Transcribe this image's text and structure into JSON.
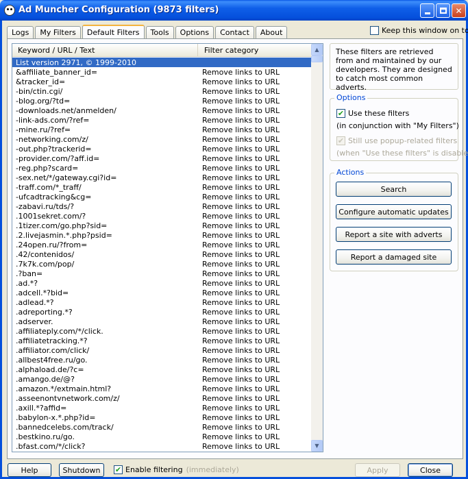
{
  "window": {
    "title": "Ad Muncher Configuration (9873 filters)"
  },
  "tabs": [
    {
      "label": "Logs",
      "active": false
    },
    {
      "label": "My Filters",
      "active": false
    },
    {
      "label": "Default Filters",
      "active": true
    },
    {
      "label": "Tools",
      "active": false
    },
    {
      "label": "Options",
      "active": false
    },
    {
      "label": "Contact",
      "active": false
    },
    {
      "label": "About",
      "active": false
    }
  ],
  "keep_on_top": {
    "label": "Keep this window on top",
    "checked": false
  },
  "list": {
    "columns": [
      "Keyword / URL / Text",
      "Filter category"
    ],
    "rows": [
      {
        "keyword": "List version 2971, © 1999-2010",
        "category": "",
        "selected": true
      },
      {
        "keyword": "&affiliate_banner_id=",
        "category": "Remove links to URL"
      },
      {
        "keyword": "&tracker_id=",
        "category": "Remove links to URL"
      },
      {
        "keyword": "-bin/ctin.cgi/",
        "category": "Remove links to URL"
      },
      {
        "keyword": "-blog.org/?td=",
        "category": "Remove links to URL"
      },
      {
        "keyword": "-downloads.net/anmelden/",
        "category": "Remove links to URL"
      },
      {
        "keyword": "-link-ads.com/?ref=",
        "category": "Remove links to URL"
      },
      {
        "keyword": "-mine.ru/?ref=",
        "category": "Remove links to URL"
      },
      {
        "keyword": "-networking.com/z/",
        "category": "Remove links to URL"
      },
      {
        "keyword": "-out.php?trackerid=",
        "category": "Remove links to URL"
      },
      {
        "keyword": "-provider.com/?aff.id=",
        "category": "Remove links to URL"
      },
      {
        "keyword": "-reg.php?scard=",
        "category": "Remove links to URL"
      },
      {
        "keyword": "-sex.net/*/gateway.cgi?id=",
        "category": "Remove links to URL"
      },
      {
        "keyword": "-traff.com/*_traff/",
        "category": "Remove links to URL"
      },
      {
        "keyword": "-ufcadtracking&cg=",
        "category": "Remove links to URL"
      },
      {
        "keyword": "-zabavi.ru/tds/?",
        "category": "Remove links to URL"
      },
      {
        "keyword": ".1001sekret.com/?",
        "category": "Remove links to URL"
      },
      {
        "keyword": ".1tizer.com/go.php?sid=",
        "category": "Remove links to URL"
      },
      {
        "keyword": ".2.livejasmin.*.php?psid=",
        "category": "Remove links to URL"
      },
      {
        "keyword": ".24open.ru/?from=",
        "category": "Remove links to URL"
      },
      {
        "keyword": ".42/contenidos/",
        "category": "Remove links to URL"
      },
      {
        "keyword": ".7k7k.com/pop/",
        "category": "Remove links to URL"
      },
      {
        "keyword": ".?ban=",
        "category": "Remove links to URL"
      },
      {
        "keyword": ".ad.*?",
        "category": "Remove links to URL"
      },
      {
        "keyword": ".adcell.*?bid=",
        "category": "Remove links to URL"
      },
      {
        "keyword": ".adlead.*?",
        "category": "Remove links to URL"
      },
      {
        "keyword": ".adreporting.*?",
        "category": "Remove links to URL"
      },
      {
        "keyword": ".adserver.",
        "category": "Remove links to URL"
      },
      {
        "keyword": ".affiliateply.com/*/click.",
        "category": "Remove links to URL"
      },
      {
        "keyword": ".affiliatetracking.*?",
        "category": "Remove links to URL"
      },
      {
        "keyword": ".affiliator.com/click/",
        "category": "Remove links to URL"
      },
      {
        "keyword": ".allbest4free.ru/go.",
        "category": "Remove links to URL"
      },
      {
        "keyword": ".alphaload.de/?c=",
        "category": "Remove links to URL"
      },
      {
        "keyword": ".amango.de/@?",
        "category": "Remove links to URL"
      },
      {
        "keyword": ".amazon.*/extmain.html?",
        "category": "Remove links to URL"
      },
      {
        "keyword": ".asseenontvnetwork.com/z/",
        "category": "Remove links to URL"
      },
      {
        "keyword": ".axill.*?affid=",
        "category": "Remove links to URL"
      },
      {
        "keyword": ".babylon-x.*.php?id=",
        "category": "Remove links to URL"
      },
      {
        "keyword": ".bannedcelebs.com/track/",
        "category": "Remove links to URL"
      },
      {
        "keyword": ".bestkino.ru/go.",
        "category": "Remove links to URL"
      },
      {
        "keyword": ".bfast.com/*/click?",
        "category": "Remove links to URL"
      }
    ]
  },
  "info": {
    "text": "These filters are retrieved from and maintained by our developers.  They are designed to catch most common adverts."
  },
  "options": {
    "title": "Options",
    "use_filters": {
      "label": "Use these filters",
      "checked": true
    },
    "use_filters_note": "(in conjunction with \"My Filters\")",
    "popup_filters": {
      "label": "Still use popup-related filters",
      "checked": true,
      "disabled": true
    },
    "popup_filters_note": "(when \"Use these filters\" is disabled)"
  },
  "actions": {
    "title": "Actions",
    "search": "Search",
    "configure_updates": "Configure automatic updates",
    "report_adverts": "Report a site with adverts",
    "report_damaged": "Report a damaged site"
  },
  "bottom": {
    "help": "Help",
    "shutdown": "Shutdown",
    "enable_filtering": {
      "label": "Enable filtering",
      "checked": true
    },
    "immediately": "(immediately)",
    "apply": "Apply",
    "close": "Close"
  },
  "colors": {
    "titlebar": "#0550dc",
    "selection": "#316ac5",
    "group_title": "#0046d5",
    "checkmark": "#21a121"
  }
}
